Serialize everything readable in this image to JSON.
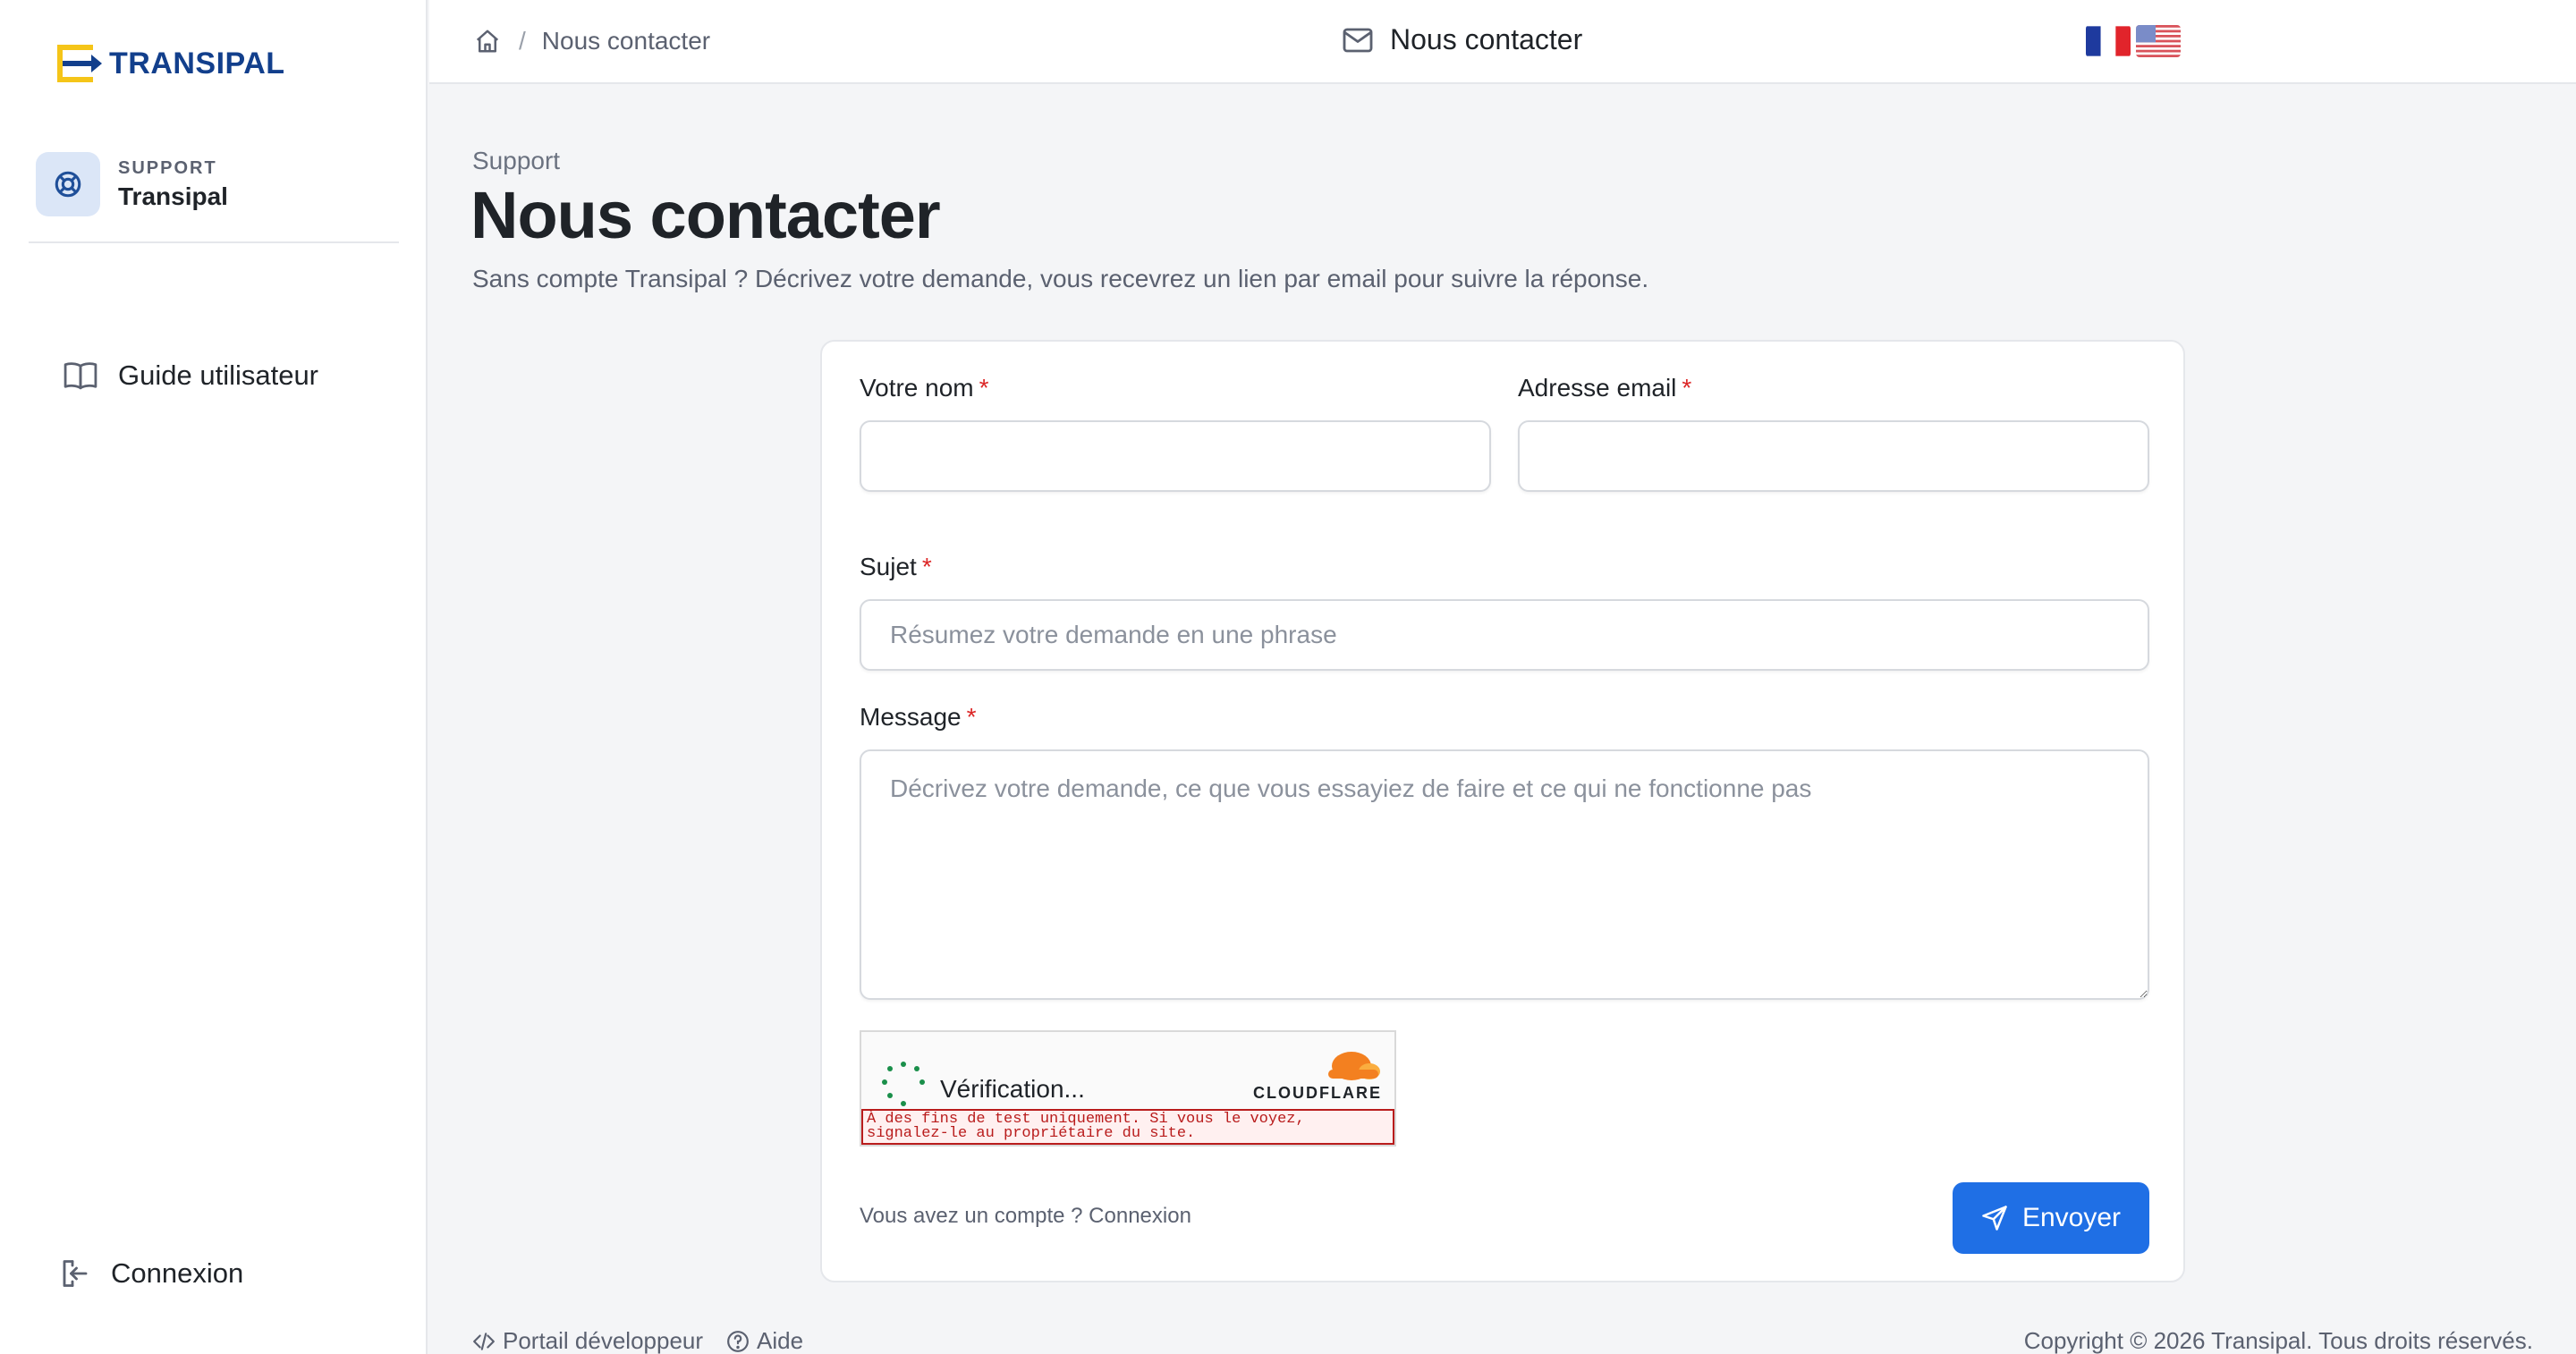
{
  "brand": {
    "name": "TRANSIPAL",
    "primary_color": "#123f8c",
    "accent_color": "#f5c518"
  },
  "sidebar": {
    "support_small": "SUPPORT",
    "support_name": "Transipal",
    "items": [
      {
        "label": "Guide utilisateur",
        "icon": "book-icon"
      }
    ],
    "bottom_item": {
      "label": "Connexion",
      "icon": "login-icon"
    }
  },
  "header": {
    "breadcrumb": {
      "home_icon": "home-icon",
      "separator": "/",
      "current": "Nous contacter"
    },
    "languages": [
      "fr",
      "en-us"
    ],
    "contact_label": "Nous contacter"
  },
  "page": {
    "kicker": "Support",
    "title": "Nous contacter",
    "subtitle": "Sans compte Transipal ? Décrivez votre demande, vous recevrez un lien par email pour suivre la réponse."
  },
  "form": {
    "required_mark": "*",
    "name": {
      "label": "Votre nom",
      "value": "",
      "placeholder": ""
    },
    "email": {
      "label": "Adresse email",
      "value": "",
      "placeholder": ""
    },
    "subject": {
      "label": "Sujet",
      "value": "",
      "placeholder": "Résumez votre demande en une phrase"
    },
    "message": {
      "label": "Message",
      "value": "",
      "placeholder": "Décrivez votre demande, ce que vous essayiez de faire et ce qui ne fonctionne pas"
    },
    "captcha": {
      "status": "Vérification...",
      "provider": "CLOUDFLARE",
      "warning": "À des fins de test uniquement. Si vous le voyez, signalez-le au propriétaire du site."
    },
    "login_prompt": "Vous avez un compte ? Connexion",
    "submit_label": "Envoyer",
    "submit_color": "#1f6fe5"
  },
  "footer": {
    "links": [
      {
        "label": "Portail développeur",
        "icon": "code-icon"
      },
      {
        "label": "Aide",
        "icon": "help-circle-icon"
      }
    ],
    "copyright": "Copyright © 2026 Transipal. Tous droits réservés."
  }
}
